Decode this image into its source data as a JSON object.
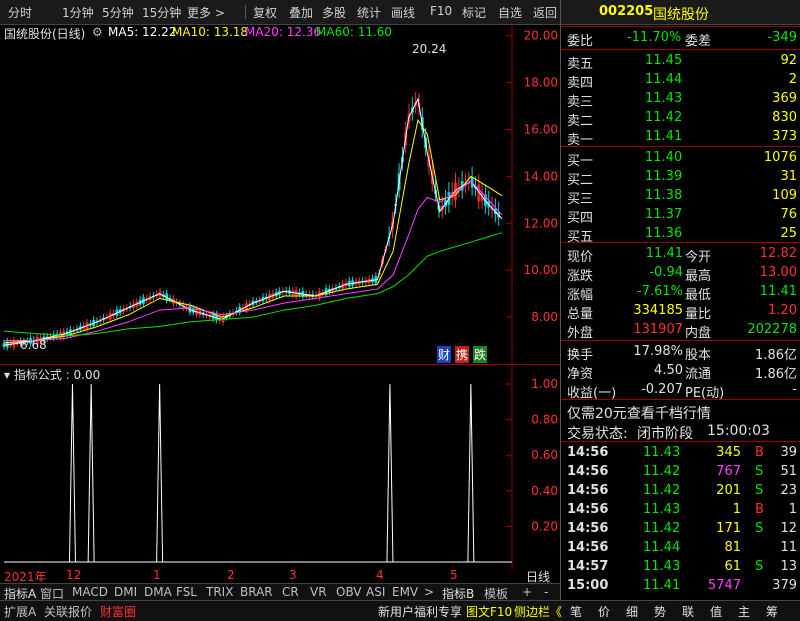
{
  "toolbar": {
    "items": [
      "分时",
      "1分钟",
      "5分钟",
      "15分钟",
      "更多 >",
      "复权",
      "叠加",
      "多股",
      "统计",
      "画线",
      "F10",
      "标记",
      "自选",
      "返回"
    ]
  },
  "stock": {
    "code": "002205",
    "name": "国统股份",
    "chart_title": "国统股份(日线)"
  },
  "ma": {
    "ma5": "MA5: 12.22",
    "ma10": "MA10: 13.18",
    "ma20": "MA20: 12.36",
    "ma60": "MA60: 11.60",
    "colors": {
      "ma5": "#ffffff",
      "ma10": "#ffff00",
      "ma20": "#ff40ff",
      "ma60": "#00e600"
    }
  },
  "chart_annotations": {
    "high_label": "20.24",
    "low_label": "6.68",
    "badges": [
      "财",
      "携",
      "跌"
    ]
  },
  "indicator": {
    "title": "指标公式 : 0.00"
  },
  "time_axis": {
    "labels": [
      "2021年",
      "12",
      "1",
      "2",
      "3",
      "4",
      "5"
    ],
    "right_label": "日线"
  },
  "tabs": {
    "items": [
      "指标A",
      "窗口",
      "MACD",
      "DMI",
      "DMA",
      "FSL",
      "TRIX",
      "BRAR",
      "CR",
      "VR",
      "OBV",
      "ASI",
      "EMV",
      ">",
      "指标B",
      "模板"
    ],
    "plus": "+",
    "minus": "-"
  },
  "bottombar": {
    "left": [
      "扩展A",
      "关联报价",
      "财富圈"
    ],
    "promo": "新用户福利专享",
    "f10": "图文F10",
    "side": "侧边栏《",
    "right": [
      "笔",
      "价",
      "细",
      "势",
      "联",
      "值",
      "主",
      "筹"
    ]
  },
  "quote": {
    "weibi_label": "委比",
    "weibi": "-11.70%",
    "weicha_label": "委差",
    "weicha": "-349",
    "asks": [
      {
        "label": "卖五",
        "price": "11.45",
        "vol": "92"
      },
      {
        "label": "卖四",
        "price": "11.44",
        "vol": "2"
      },
      {
        "label": "卖三",
        "price": "11.43",
        "vol": "369"
      },
      {
        "label": "卖二",
        "price": "11.42",
        "vol": "830"
      },
      {
        "label": "卖一",
        "price": "11.41",
        "vol": "373"
      }
    ],
    "bids": [
      {
        "label": "买一",
        "price": "11.40",
        "vol": "1076"
      },
      {
        "label": "买二",
        "price": "11.39",
        "vol": "31"
      },
      {
        "label": "买三",
        "price": "11.38",
        "vol": "109"
      },
      {
        "label": "买四",
        "price": "11.37",
        "vol": "76"
      },
      {
        "label": "买五",
        "price": "11.36",
        "vol": "25"
      }
    ],
    "stats": [
      {
        "l1": "现价",
        "v1": "11.41",
        "c1": "green",
        "l2": "今开",
        "v2": "12.82",
        "c2": "red"
      },
      {
        "l1": "涨跌",
        "v1": "-0.94",
        "c1": "green",
        "l2": "最高",
        "v2": "13.00",
        "c2": "red"
      },
      {
        "l1": "涨幅",
        "v1": "-7.61%",
        "c1": "green",
        "l2": "最低",
        "v2": "11.41",
        "c2": "green"
      },
      {
        "l1": "总量",
        "v1": "334185",
        "c1": "yellow",
        "l2": "量比",
        "v2": "1.20",
        "c2": "red"
      },
      {
        "l1": "外盘",
        "v1": "131907",
        "c1": "red",
        "l2": "内盘",
        "v2": "202278",
        "c2": "green"
      }
    ],
    "stats2": [
      {
        "l1": "换手",
        "v1": "17.98%",
        "l2": "股本",
        "v2": "1.86亿"
      },
      {
        "l1": "净资",
        "v1": "4.50",
        "l2": "流通",
        "v2": "1.86亿"
      },
      {
        "l1": "收益(一)",
        "v1": "-0.207",
        "l2": "PE(动)",
        "v2": "-"
      }
    ],
    "promo": "仅需20元查看千档行情",
    "trade_status_label": "交易状态:",
    "trade_status": "闭市阶段",
    "trade_time": "15:00:03",
    "ticks": [
      {
        "t": "14:56",
        "p": "11.43",
        "v": "345",
        "vc": "yellow",
        "s": "B",
        "sc": "red",
        "n": "39"
      },
      {
        "t": "14:56",
        "p": "11.42",
        "v": "767",
        "vc": "magenta",
        "s": "S",
        "sc": "green",
        "n": "51"
      },
      {
        "t": "14:56",
        "p": "11.42",
        "v": "201",
        "vc": "yellow",
        "s": "S",
        "sc": "green",
        "n": "23"
      },
      {
        "t": "14:56",
        "p": "11.43",
        "v": "1",
        "vc": "yellow",
        "s": "B",
        "sc": "red",
        "n": "1"
      },
      {
        "t": "14:56",
        "p": "11.42",
        "v": "171",
        "vc": "yellow",
        "s": "S",
        "sc": "green",
        "n": "12"
      },
      {
        "t": "14:56",
        "p": "11.44",
        "v": "81",
        "vc": "yellow",
        "s": "",
        "sc": "green",
        "n": "11"
      },
      {
        "t": "14:57",
        "p": "11.43",
        "v": "61",
        "vc": "yellow",
        "s": "S",
        "sc": "green",
        "n": "13"
      },
      {
        "t": "15:00",
        "p": "11.41",
        "v": "5747",
        "vc": "magenta",
        "s": "",
        "sc": "green",
        "n": "379"
      }
    ]
  },
  "chart_data": [
    {
      "type": "line",
      "title": "国统股份(日线)",
      "ylim": [
        6.0,
        20.5
      ],
      "yticks": [
        8.0,
        10.0,
        12.0,
        14.0,
        16.0,
        18.0,
        20.0
      ],
      "x": [
        0,
        10,
        20,
        30,
        40,
        50,
        60,
        70,
        80,
        90,
        100,
        110,
        120,
        125,
        130,
        133,
        136,
        140,
        145,
        150,
        155,
        160
      ],
      "series": [
        {
          "name": "MA5",
          "color": "#ffffff",
          "values": [
            6.8,
            7.0,
            7.3,
            7.8,
            8.4,
            9.0,
            8.3,
            7.9,
            8.6,
            9.1,
            8.9,
            9.4,
            9.6,
            12.0,
            16.5,
            17.3,
            15.0,
            12.5,
            13.4,
            13.8,
            12.9,
            12.2
          ]
        },
        {
          "name": "MA10",
          "color": "#ffff00",
          "values": [
            6.9,
            7.0,
            7.2,
            7.6,
            8.1,
            8.8,
            8.5,
            8.0,
            8.4,
            8.9,
            8.9,
            9.2,
            9.4,
            10.8,
            14.5,
            16.4,
            15.8,
            13.0,
            13.2,
            14.0,
            13.6,
            13.18
          ]
        },
        {
          "name": "MA20",
          "color": "#ff40ff",
          "values": [
            7.0,
            7.0,
            7.1,
            7.4,
            7.8,
            8.3,
            8.4,
            8.1,
            8.3,
            8.6,
            8.8,
            9.0,
            9.2,
            9.8,
            11.5,
            12.6,
            13.1,
            12.9,
            13.3,
            13.8,
            13.1,
            12.36
          ]
        },
        {
          "name": "MA60",
          "color": "#00e600",
          "values": [
            7.4,
            7.3,
            7.2,
            7.3,
            7.5,
            7.6,
            7.8,
            7.9,
            8.0,
            8.3,
            8.5,
            8.8,
            9.0,
            9.3,
            9.8,
            10.2,
            10.6,
            10.8,
            11.0,
            11.2,
            11.4,
            11.6
          ]
        }
      ]
    },
    {
      "type": "line",
      "title": "指标公式 : 0.00",
      "ylim": [
        0,
        1.0
      ],
      "yticks": [
        0.2,
        0.4,
        0.6,
        0.8,
        1.0
      ],
      "spikes_x": [
        22,
        28,
        50,
        124,
        150
      ],
      "value": 1.0
    }
  ]
}
